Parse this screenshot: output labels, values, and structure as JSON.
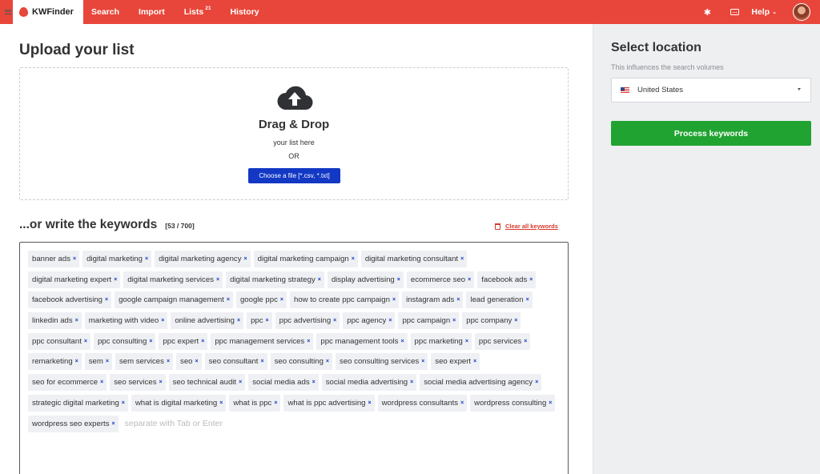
{
  "topbar": {
    "brand": "KWFinder",
    "nav": [
      {
        "label": "Search"
      },
      {
        "label": "Import"
      },
      {
        "label": "Lists",
        "badge": "21"
      },
      {
        "label": "History"
      }
    ],
    "help_label": "Help",
    "icons": [
      "menu-icon",
      "gear-icon",
      "keyboard-icon",
      "chevron-down-icon"
    ],
    "accent_color": "#e8463a"
  },
  "upload": {
    "title": "Upload your list",
    "drop_title": "Drag & Drop",
    "drop_sub": "your list here",
    "or_text": "OR",
    "choose_button": "Choose a file [*.csv, *.txt]"
  },
  "keywords": {
    "title": "...or write the keywords",
    "count": "[53 / 700]",
    "clear_label": "Clear all keywords",
    "placeholder": "separate with Tab or Enter",
    "tags": [
      "banner ads",
      "digital marketing",
      "digital marketing agency",
      "digital marketing campaign",
      "digital marketing consultant",
      "digital marketing expert",
      "digital marketing services",
      "digital marketing strategy",
      "display advertising",
      "ecommerce seo",
      "facebook ads",
      "facebook advertising",
      "google campaign management",
      "google ppc",
      "how to create ppc campaign",
      "instagram ads",
      "lead generation",
      "linkedin ads",
      "marketing with video",
      "online advertising",
      "ppc",
      "ppc advertising",
      "ppc agency",
      "ppc campaign",
      "ppc company",
      "ppc consultant",
      "ppc consulting",
      "ppc expert",
      "ppc management services",
      "ppc management tools",
      "ppc marketing",
      "ppc services",
      "remarketing",
      "sem",
      "sem services",
      "seo",
      "seo consultant",
      "seo consulting",
      "seo consulting services",
      "seo expert",
      "seo for ecommerce",
      "seo services",
      "seo technical audit",
      "social media ads",
      "social media advertising",
      "social media advertising agency",
      "strategic digital marketing",
      "what is digital marketing",
      "what is ppc",
      "what is ppc advertising",
      "wordpress consultants",
      "wordpress consulting",
      "wordpress seo experts"
    ],
    "remove_symbol": "×"
  },
  "location": {
    "title": "Select location",
    "subtitle": "This influences the search volumes",
    "selected": "United States",
    "process_button": "Process keywords",
    "button_color": "#21a332"
  }
}
